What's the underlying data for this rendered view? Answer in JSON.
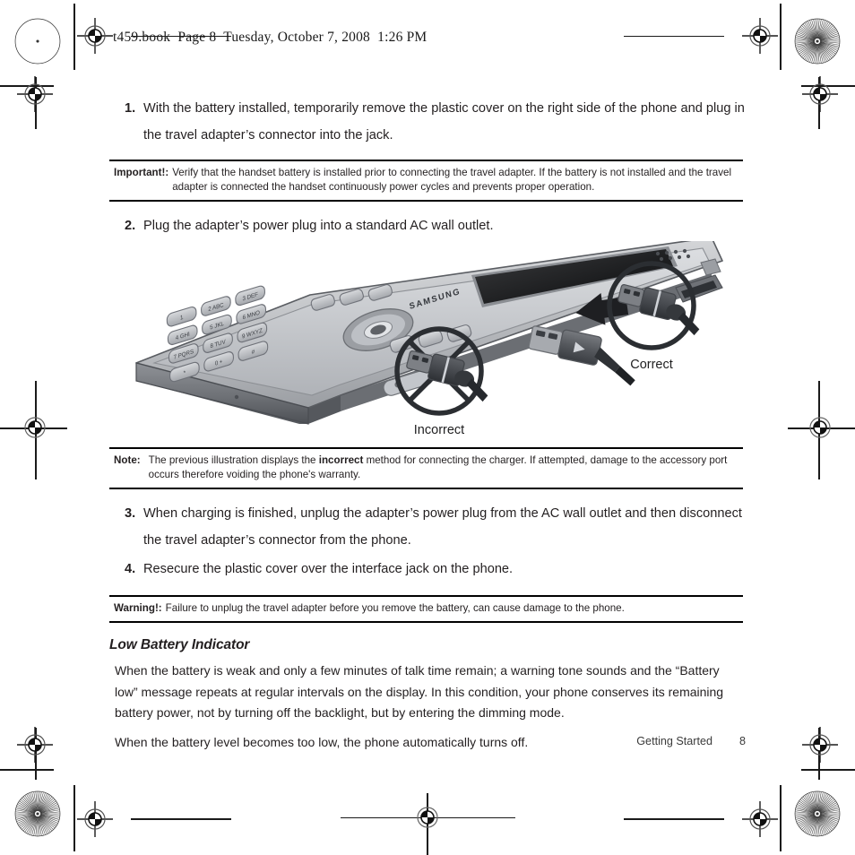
{
  "document": {
    "file_header": "t459.book  Page 8  Tuesday, October 7, 2008  1:26 PM"
  },
  "steps": [
    {
      "number": "1.",
      "text": "With the battery installed, temporarily remove the plastic cover on the right side of the phone and plug in the travel adapter’s connector into the jack."
    },
    {
      "number": "2.",
      "text": "Plug the adapter’s power plug into a standard AC wall outlet."
    },
    {
      "number": "3.",
      "text": "When charging is finished, unplug the adapter’s power plug from the AC wall outlet and then disconnect the travel adapter’s connector from the phone."
    },
    {
      "number": "4.",
      "text": "Resecure the plastic cover over the interface jack on the phone."
    }
  ],
  "admonitions": {
    "important": {
      "label": "Important!:",
      "text": "Verify that the handset battery is installed prior to connecting the travel adapter. If the battery is not installed and the travel adapter is connected the handset continuously power cycles and prevents proper operation."
    },
    "note": {
      "label": "Note:",
      "text_before": "The previous illustration displays the ",
      "emphasis": "incorrect",
      "text_after": " method for connecting the charger. If attempted, damage to the accessory port occurs therefore voiding the phone's warranty."
    },
    "warning": {
      "label": "Warning!:",
      "text": "Failure to unplug the travel adapter before you remove the battery, can cause damage to the phone."
    }
  },
  "figure": {
    "caption_correct": "Correct",
    "caption_incorrect": "Incorrect",
    "phone_brand": "SAMSUNG",
    "keypad_keys": [
      "1",
      "2 ABC",
      "3 DEF",
      "4 GHI",
      "5 JKL",
      "6 MNO",
      "7 PQRS",
      "8 TUV",
      "9 WXYZ",
      "*",
      "0 +",
      "#"
    ]
  },
  "section": {
    "heading": "Low Battery Indicator",
    "paragraphs": [
      "When the battery is weak and only a few minutes of talk time remain; a warning tone sounds and the “Battery low” message repeats at regular intervals on the display. In this condition, your phone conserves its remaining battery power, not by turning off the backlight, but by entering the dimming mode.",
      "When the battery level becomes too low, the phone automatically turns off."
    ]
  },
  "footer": {
    "chapter": "Getting Started",
    "page_number": "8"
  },
  "colors": {
    "text": "#231f20",
    "rule": "#000000",
    "footer_text": "#3a3a3a"
  }
}
